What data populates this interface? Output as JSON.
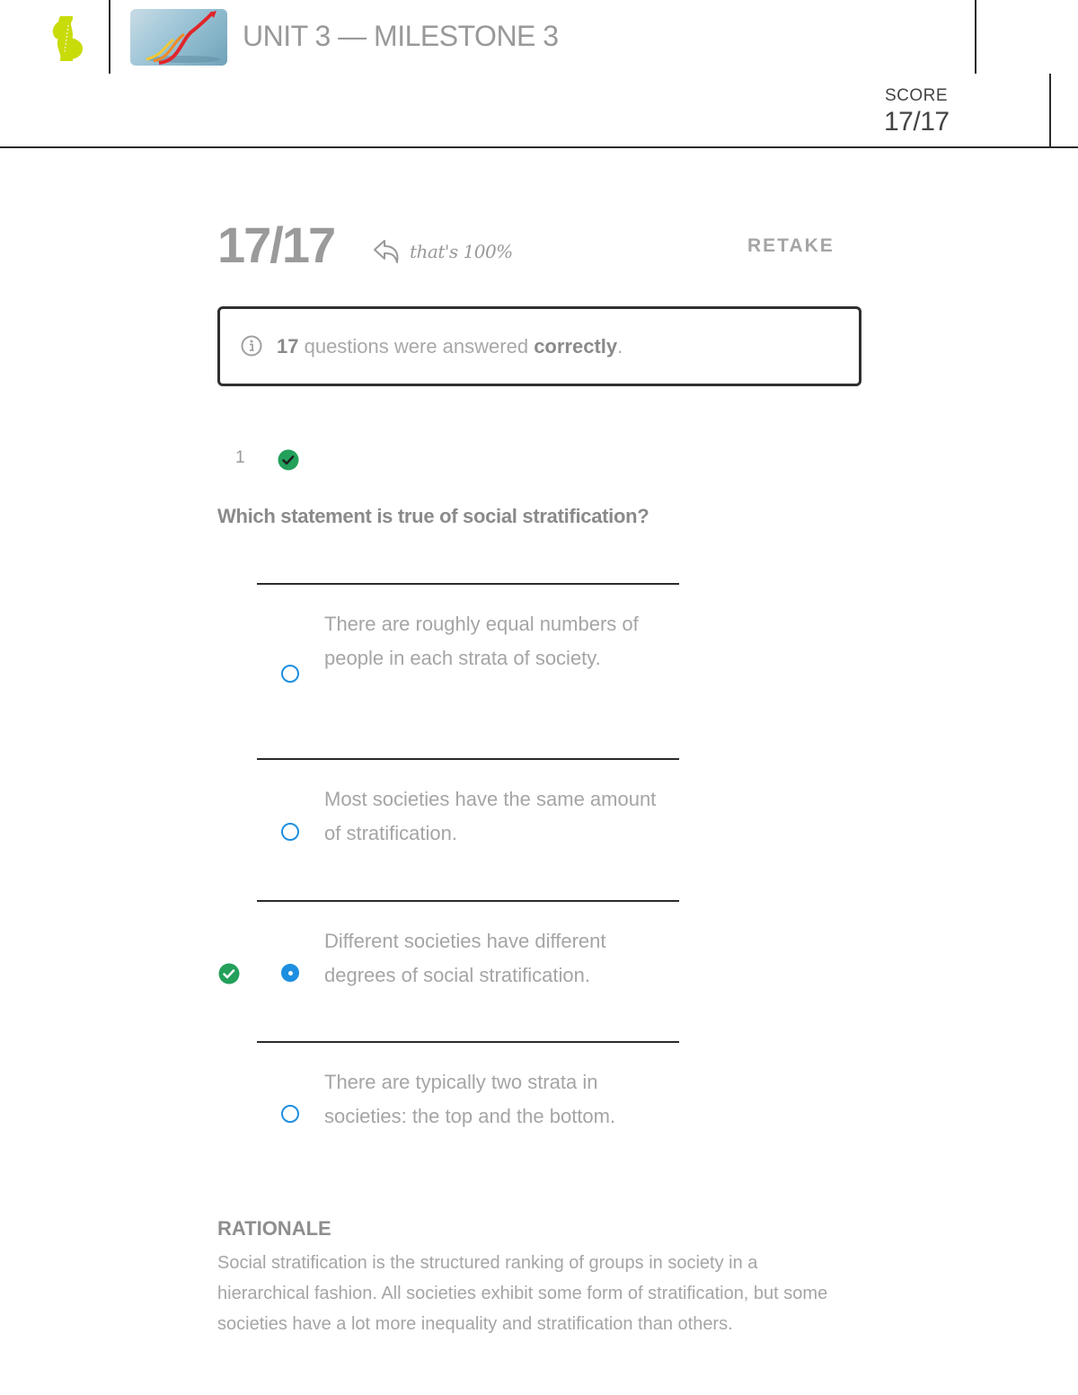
{
  "header": {
    "logo_icon": "sophia-logo-icon",
    "thumbnail_icon": "rising-arrows-thumbnail",
    "title": "UNIT 3 — MILESTONE 3",
    "score_label": "SCORE",
    "score_value": "17/17"
  },
  "summary": {
    "score": "17/17",
    "note_icon": "curved-arrow-left-icon",
    "note": "that's 100%",
    "retake_label": "RETAKE",
    "info_icon": "info-icon",
    "info_count": "17",
    "info_middle": " questions were answered ",
    "info_emphasis": "correctly",
    "info_end": "."
  },
  "question": {
    "number": "1",
    "status": "correct",
    "status_icon": "check-circle-icon",
    "text": "Which statement is true of social stratification?",
    "options": [
      {
        "text": "There are roughly equal numbers of people in each strata of society.",
        "selected": false,
        "correct": false
      },
      {
        "text": "Most societies have the same amount of stratification.",
        "selected": false,
        "correct": false
      },
      {
        "text": "Different societies have different degrees of social stratification.",
        "selected": true,
        "correct": true
      },
      {
        "text": "There are typically two strata in societies: the top and the bottom.",
        "selected": false,
        "correct": false
      }
    ]
  },
  "rationale": {
    "title": "RATIONALE",
    "text": "Social stratification is the structured ranking of groups in society in a hierarchical fashion. All societies exhibit some form of stratification, but some societies have a lot more inequality and stratification than others."
  },
  "colors": {
    "accent_blue": "#1e8fe0",
    "correct_green": "#23a05a",
    "logo_lime": "#c8dc0a"
  }
}
